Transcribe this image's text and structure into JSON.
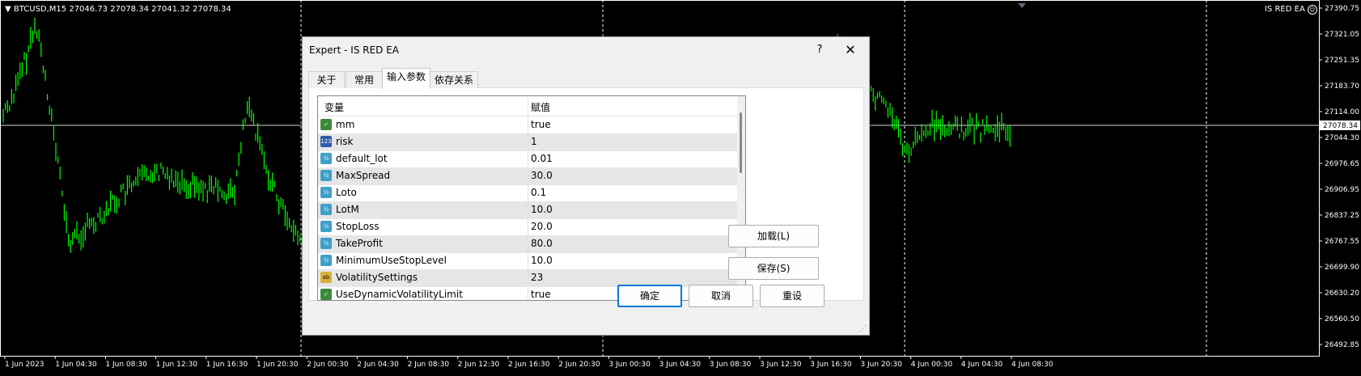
{
  "chart": {
    "title": "BTCUSD,M15  27046.73 27078.34 27041.32 27078.34",
    "ea_label": "IS RED EA",
    "current_price": "27078.34",
    "y_ticks": [
      "27390.75",
      "27321.05",
      "27251.35",
      "27183.70",
      "27114.00",
      "27044.30",
      "26976.65",
      "26906.95",
      "26837.25",
      "26767.55",
      "26699.90",
      "26630.20",
      "26560.50",
      "26492.85"
    ],
    "x_ticks": [
      "1 Jun 2023",
      "1 Jun 04:30",
      "1 Jun 08:30",
      "1 Jun 12:30",
      "1 Jun 16:30",
      "1 Jun 20:30",
      "2 Jun 00:30",
      "2 Jun 04:30",
      "2 Jun 08:30",
      "2 Jun 12:30",
      "2 Jun 16:30",
      "2 Jun 20:30",
      "3 Jun 00:30",
      "3 Jun 04:30",
      "3 Jun 08:30",
      "3 Jun 12:30",
      "3 Jun 16:30",
      "3 Jun 20:30",
      "4 Jun 00:30",
      "4 Jun 04:30",
      "4 Jun 08:30"
    ],
    "colors": {
      "background": "#000000",
      "bars": "#00ff00",
      "grid": "#ffffff",
      "text": "#ffffff"
    }
  },
  "dialog": {
    "title": "Expert - IS RED EA",
    "help_label": "?",
    "close_label": "✕",
    "tabs": [
      {
        "label": "关于",
        "active": false
      },
      {
        "label": "常用",
        "active": false
      },
      {
        "label": "输入参数",
        "active": true
      },
      {
        "label": "依存关系",
        "active": false
      }
    ],
    "table": {
      "col_variable": "变量",
      "col_value": "赋值",
      "rows": [
        {
          "type": "bool",
          "icon": "bool-icon",
          "name": "mm",
          "value": "true"
        },
        {
          "type": "int",
          "icon": "int-icon",
          "name": "risk",
          "value": "1"
        },
        {
          "type": "dbl",
          "icon": "double-icon",
          "name": "default_lot",
          "value": "0.01"
        },
        {
          "type": "dbl",
          "icon": "double-icon",
          "name": "MaxSpread",
          "value": "30.0"
        },
        {
          "type": "dbl",
          "icon": "double-icon",
          "name": "Loto",
          "value": "0.1"
        },
        {
          "type": "dbl",
          "icon": "double-icon",
          "name": "LotM",
          "value": "10.0"
        },
        {
          "type": "dbl",
          "icon": "double-icon",
          "name": "StopLoss",
          "value": "20.0"
        },
        {
          "type": "dbl",
          "icon": "double-icon",
          "name": "TakeProfit",
          "value": "80.0"
        },
        {
          "type": "dbl",
          "icon": "double-icon",
          "name": "MinimumUseStopLevel",
          "value": "10.0"
        },
        {
          "type": "str",
          "icon": "string-icon",
          "name": "VolatilitySettings",
          "value": "23"
        },
        {
          "type": "bool",
          "icon": "bool-icon",
          "name": "UseDynamicVolatilityLimit",
          "value": "true"
        }
      ]
    },
    "buttons": {
      "load": "加载(L)",
      "save": "保存(S)",
      "ok": "确定",
      "cancel": "取消",
      "reset": "重设"
    }
  }
}
